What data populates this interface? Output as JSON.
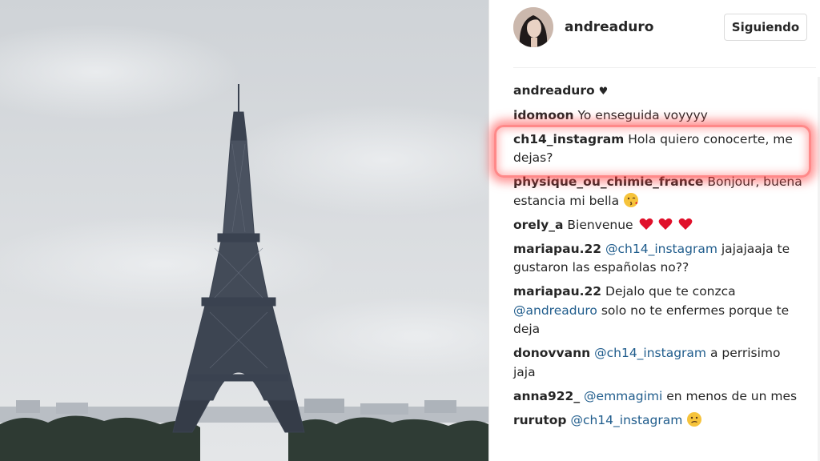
{
  "post": {
    "username": "andreaduro",
    "follow_label": "Siguiendo",
    "caption_user": "andreaduro",
    "caption_text": "♥"
  },
  "comments": [
    {
      "user": "idomoon",
      "parts": [
        {
          "t": "text",
          "v": "Yo enseguida voyyyy"
        }
      ]
    },
    {
      "user": "ch14_instagram",
      "parts": [
        {
          "t": "text",
          "v": "Hola quiero conocerte, me dejas?"
        }
      ]
    },
    {
      "user": "physique_ou_chimie_france",
      "parts": [
        {
          "t": "text",
          "v": "Bonjour, buena estancia mi bella"
        },
        {
          "t": "emoji",
          "v": "kissing-face-emoji"
        }
      ]
    },
    {
      "user": "orely_a",
      "parts": [
        {
          "t": "text",
          "v": "Bienvenue"
        },
        {
          "t": "emoji",
          "v": "red-heart-emoji"
        },
        {
          "t": "emoji",
          "v": "red-heart-emoji"
        },
        {
          "t": "emoji",
          "v": "red-heart-emoji"
        }
      ]
    },
    {
      "user": "mariapau.22",
      "parts": [
        {
          "t": "mention",
          "v": "@ch14_instagram"
        },
        {
          "t": "text",
          "v": "jajajaaja te gustaron las españolas no??"
        }
      ]
    },
    {
      "user": "mariapau.22",
      "parts": [
        {
          "t": "text",
          "v": "Dejalo que te conzca"
        },
        {
          "t": "mention",
          "v": "@andreaduro"
        },
        {
          "t": "text",
          "v": "solo no te enfermes porque te deja"
        }
      ]
    },
    {
      "user": "donovvann",
      "parts": [
        {
          "t": "mention",
          "v": "@ch14_instagram"
        },
        {
          "t": "text",
          "v": "a perrisimo jaja"
        }
      ]
    },
    {
      "user": "anna922_",
      "parts": [
        {
          "t": "mention",
          "v": "@emmagimi"
        },
        {
          "t": "text",
          "v": "en menos de un mes"
        }
      ]
    },
    {
      "user": "rurutop",
      "parts": [
        {
          "t": "mention",
          "v": "@ch14_instagram"
        },
        {
          "t": "emoji",
          "v": "confused-face-emoji"
        }
      ]
    }
  ],
  "colors": {
    "mention": "#1f5c8c",
    "highlight": "#ff2828",
    "sky": "#d8dbde",
    "tower": "#3a4250"
  }
}
